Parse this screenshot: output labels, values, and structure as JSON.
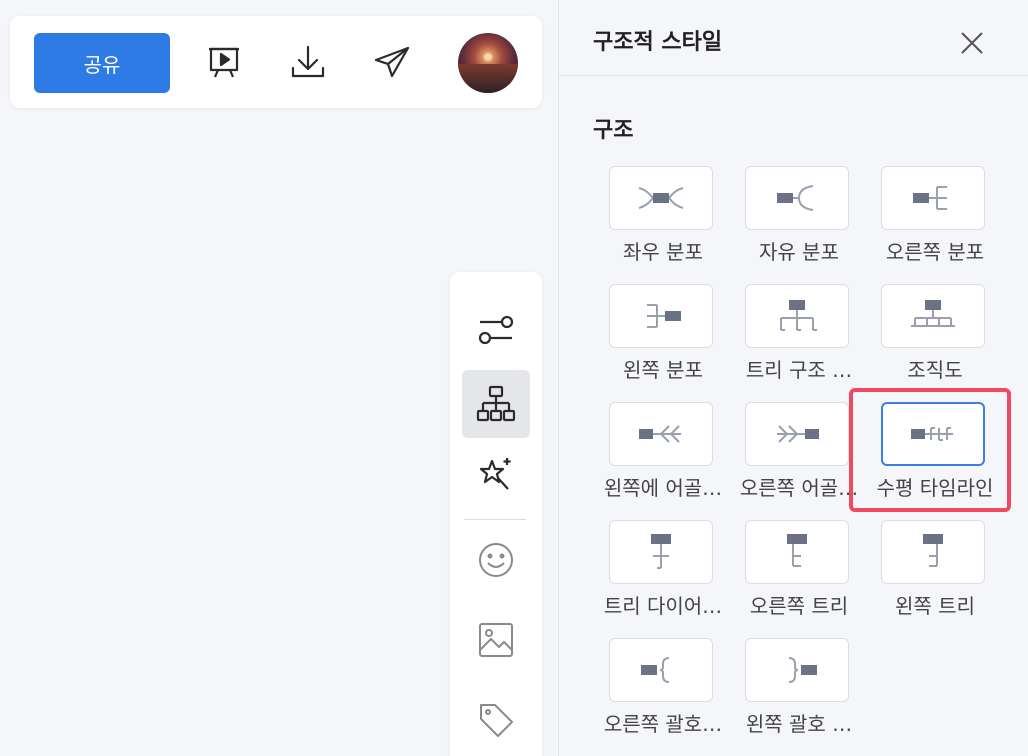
{
  "toolbar": {
    "share_label": "공유",
    "icons": [
      "presentation-icon",
      "download-icon",
      "send-icon"
    ],
    "avatar": "avatar"
  },
  "sidebar": {
    "items": [
      "style-settings-icon",
      "structure-icon",
      "magic-star-icon",
      "emoji-icon",
      "image-icon",
      "tag-icon"
    ],
    "active": "structure-icon"
  },
  "panel": {
    "title": "구조적 스타일",
    "section_title": "구조",
    "options": [
      {
        "label": "좌우 분포",
        "icon": "both-sides-structure-icon"
      },
      {
        "label": "자유 분포",
        "icon": "free-structure-icon"
      },
      {
        "label": "오른쪽 분포",
        "icon": "right-structure-icon"
      },
      {
        "label": "왼쪽 분포",
        "icon": "left-structure-icon"
      },
      {
        "label": "트리 구조 …",
        "icon": "tree-structure-icon"
      },
      {
        "label": "조직도",
        "icon": "org-chart-icon"
      },
      {
        "label": "왼쪽에 어골…",
        "icon": "left-fishbone-icon"
      },
      {
        "label": "오른쪽 어골…",
        "icon": "right-fishbone-icon"
      },
      {
        "label": "수평 타임라인",
        "icon": "horizontal-timeline-icon",
        "selected": true
      },
      {
        "label": "트리 다이어…",
        "icon": "tree-diagram-icon"
      },
      {
        "label": "오른쪽 트리",
        "icon": "right-tree-icon"
      },
      {
        "label": "왼쪽 트리",
        "icon": "left-tree-icon"
      },
      {
        "label": "오른쪽 괄호…",
        "icon": "right-bracket-icon"
      },
      {
        "label": "왼쪽 괄호 …",
        "icon": "left-bracket-icon"
      }
    ]
  },
  "colors": {
    "accent": "#2f7be5",
    "selected_border": "#3b7ee8",
    "highlight": "#ef4a60",
    "node": "#6b7285",
    "line": "#9aa0ad"
  }
}
